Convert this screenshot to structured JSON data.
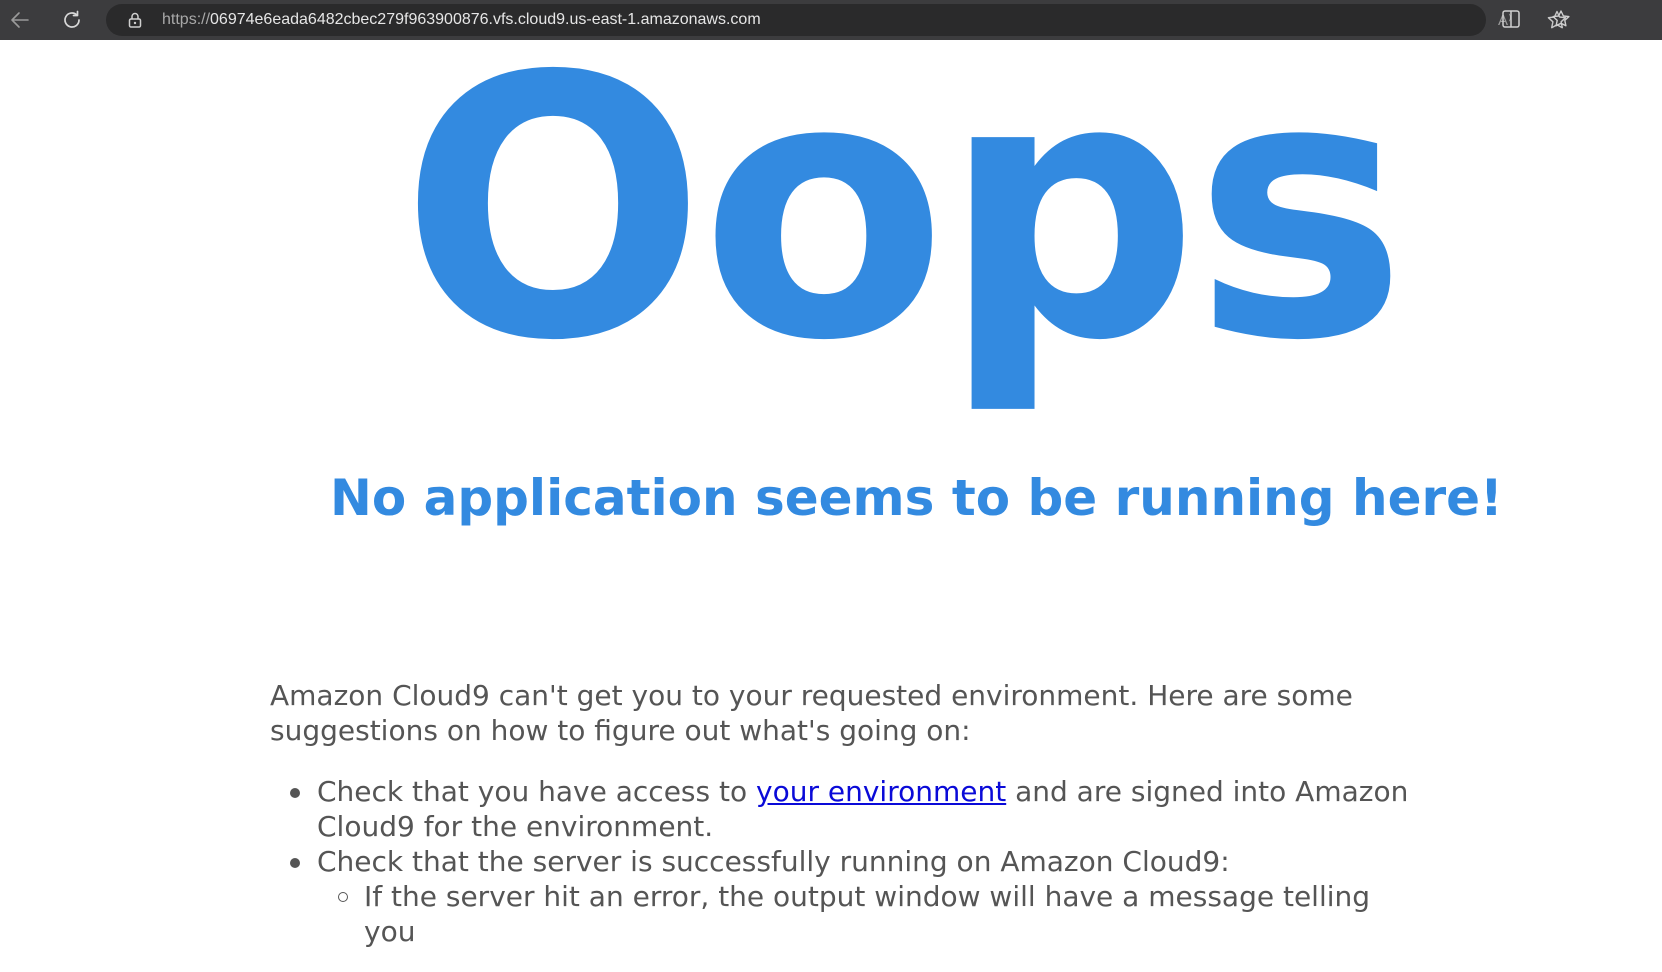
{
  "browser": {
    "url_prefix": "https://",
    "url_host": "06974e6eada6482cbec279f963900876.vfs.cloud9.us-east-1.amazonaws.com",
    "read_aloud_glyph": "A⁾",
    "icons": [
      "back-arrow-icon",
      "reload-icon",
      "lock-icon",
      "read-aloud-icon",
      "favorite-star-icon",
      "split-screen-icon",
      "collections-icon"
    ]
  },
  "page": {
    "headline": "Oops",
    "subtitle": "No application seems to be running here!",
    "intro": "Amazon Cloud9 can't get you to your requested environment. Here are some suggestions on how to figure out what's going on:",
    "suggestions": [
      {
        "before_link": "Check that you have access to ",
        "link_text": "your environment",
        "after_link": " and are signed into Amazon Cloud9 for the environment."
      },
      {
        "text": "Check that the server is successfully running on Amazon Cloud9:",
        "sub_items": [
          "If the server hit an error, the output window will have a message telling you"
        ]
      }
    ]
  },
  "colors": {
    "accent": "#338ae0",
    "body_text": "#555555",
    "link": "#0a0ad8",
    "chrome_bg": "#3c3c3e"
  }
}
